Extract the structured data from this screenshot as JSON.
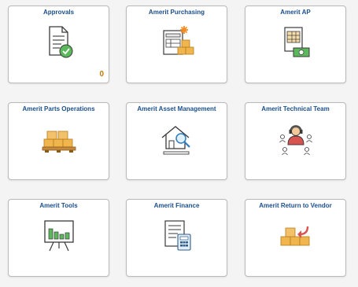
{
  "tiles": [
    {
      "title": "Approvals",
      "icon": "approvals-document-check-icon",
      "count": "0"
    },
    {
      "title": "Amerit Purchasing",
      "icon": "purchasing-form-boxes-icon"
    },
    {
      "title": "Amerit AP",
      "icon": "ap-invoice-money-icon"
    },
    {
      "title": "Amerit Parts Operations",
      "icon": "parts-pallet-boxes-icon"
    },
    {
      "title": "Amerit Asset Management",
      "icon": "asset-house-magnifier-icon"
    },
    {
      "title": "Amerit Technical Team",
      "icon": "technical-team-headset-icon"
    },
    {
      "title": "Amerit Tools",
      "icon": "tools-presentation-chart-icon"
    },
    {
      "title": "Amerit Finance",
      "icon": "finance-document-calculator-icon"
    },
    {
      "title": "Amerit Return to Vendor",
      "icon": "return-to-vendor-boxes-arrow-icon"
    }
  ],
  "colors": {
    "title": "#1b4f8b",
    "count": "#c07a00",
    "box": "#f0b54d",
    "green": "#5cb85c",
    "red": "#d9534f",
    "outline": "#3a3a3a"
  }
}
